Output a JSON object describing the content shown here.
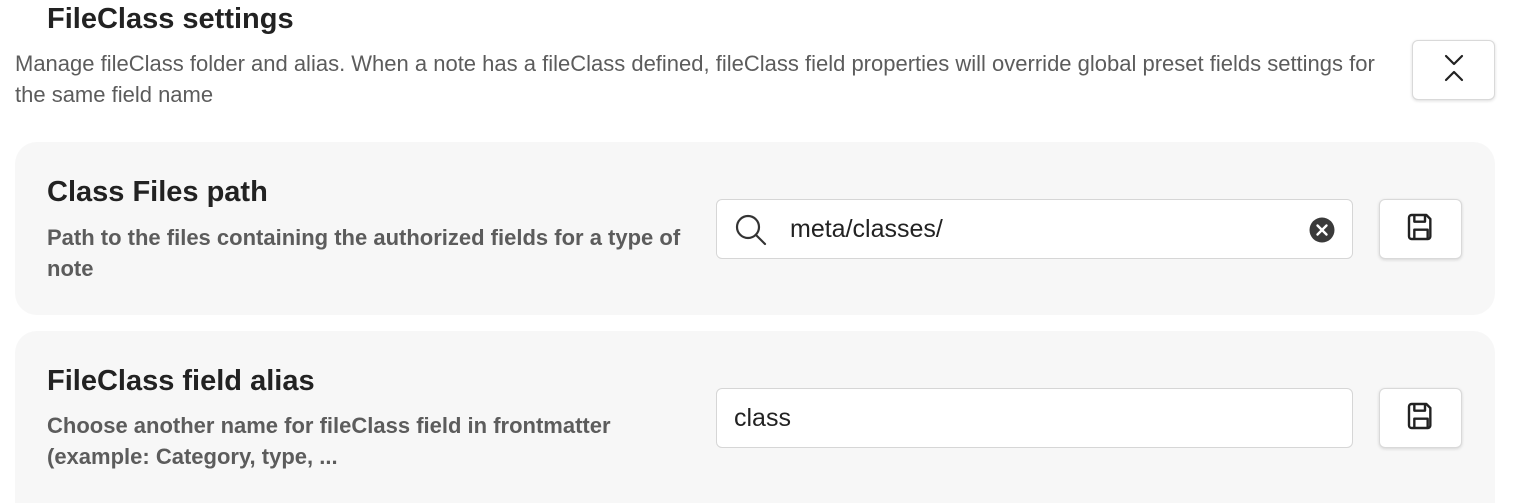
{
  "section": {
    "title": "FileClass settings",
    "description": "Manage fileClass folder and alias. When a note has a fileClass defined, fileClass field properties will override global preset fields settings for the same field name",
    "collapse_icon": "chevrons-down-up-icon"
  },
  "class_files_path": {
    "title": "Class Files path",
    "description": "Path to the files containing the authorized fields for a type of note",
    "value": "meta/classes/",
    "search_icon": "search-icon",
    "clear_icon": "clear-circle-icon",
    "save_icon": "save-icon"
  },
  "fileclass_alias": {
    "title": "FileClass field alias",
    "description": "Choose another name for fileClass field in frontmatter (example: Category, type, ...",
    "value": "class",
    "save_icon": "save-icon"
  },
  "colors": {
    "card_background": "#f7f7f7",
    "text_primary": "#222222",
    "text_muted": "#5c5c5c",
    "border": "#d6d6d6"
  }
}
